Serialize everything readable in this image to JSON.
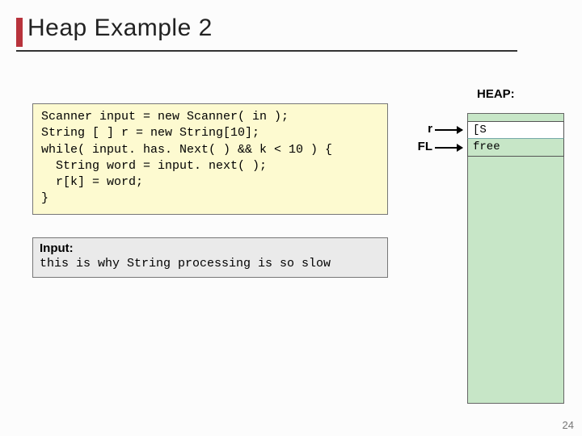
{
  "title": "Heap Example 2",
  "code": "Scanner input = new Scanner( in );\nString [ ] r = new String[10];\nwhile( input. has. Next( ) && k < 10 ) {\n  String word = input. next( );\n  r[k] = word;\n}",
  "input_label": "Input:",
  "input_text": "this is why String processing is so slow",
  "heap_label": "HEAP:",
  "pointers": {
    "r": {
      "label": "r",
      "cell": "[S"
    },
    "fl": {
      "label": "FL",
      "cell": "free"
    }
  },
  "page_number": "24"
}
